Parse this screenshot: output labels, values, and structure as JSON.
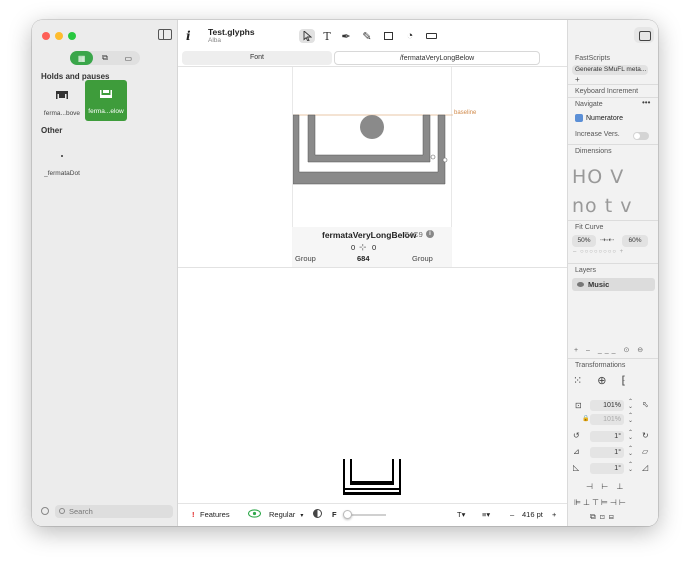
{
  "sidebar": {
    "view_modes": [
      "▦",
      "⧉",
      "▭"
    ],
    "sections": [
      {
        "title": "Holds and pauses",
        "glyphs": [
          {
            "name": "ferma...bove",
            "selected": false
          },
          {
            "name": "ferma...elow",
            "selected": true
          }
        ]
      },
      {
        "title": "Other",
        "glyphs": [
          {
            "name": "_fermataDot",
            "selected": false
          }
        ]
      }
    ],
    "search_placeholder": "Search"
  },
  "toolbar": {
    "title": "Test.glyphs",
    "subtitle": "Alba",
    "tab_font": "Font",
    "tab_glyph": "/fermataVeryLongBelow"
  },
  "canvas": {
    "baseline_label": "baseline",
    "glyph_name": "fermataVeryLongBelow",
    "unicode": "E4C9",
    "lsb": "0",
    "rsb": "0",
    "left_group": "Group",
    "right_group": "Group",
    "width": "684"
  },
  "bottombar": {
    "features_label": "Features",
    "master": "Regular",
    "f_label": "F",
    "font_size": "416 pt",
    "minus": "–",
    "plus": "+"
  },
  "panel": {
    "fastscripts_header": "FastScripts",
    "fastscripts_value": "Generate SMuFL meta...",
    "keyboard_increment": "Keyboard Increment",
    "navigate": "Navigate",
    "numeratore": "Numeratore",
    "increase_vers": "Increase Vers.",
    "dimensions": "Dimensions",
    "dim_row1": "HO V",
    "dim_row2": "no t v",
    "fit_curve": "Fit Curve",
    "fit_left": "50%",
    "fit_right": "60%",
    "layers": "Layers",
    "layer_name": "Music",
    "transformations": "Transformations",
    "scale_x": "101%",
    "scale_y": "101%",
    "rotate": "1°",
    "skew1": "1°",
    "skew2": "1°"
  },
  "colors": {
    "selected_glyph_bg": "#3e9c3b",
    "segment_on": "#3aa64a",
    "baseline": "#d08a4a",
    "glyph_fill": "#8a8a8a"
  }
}
